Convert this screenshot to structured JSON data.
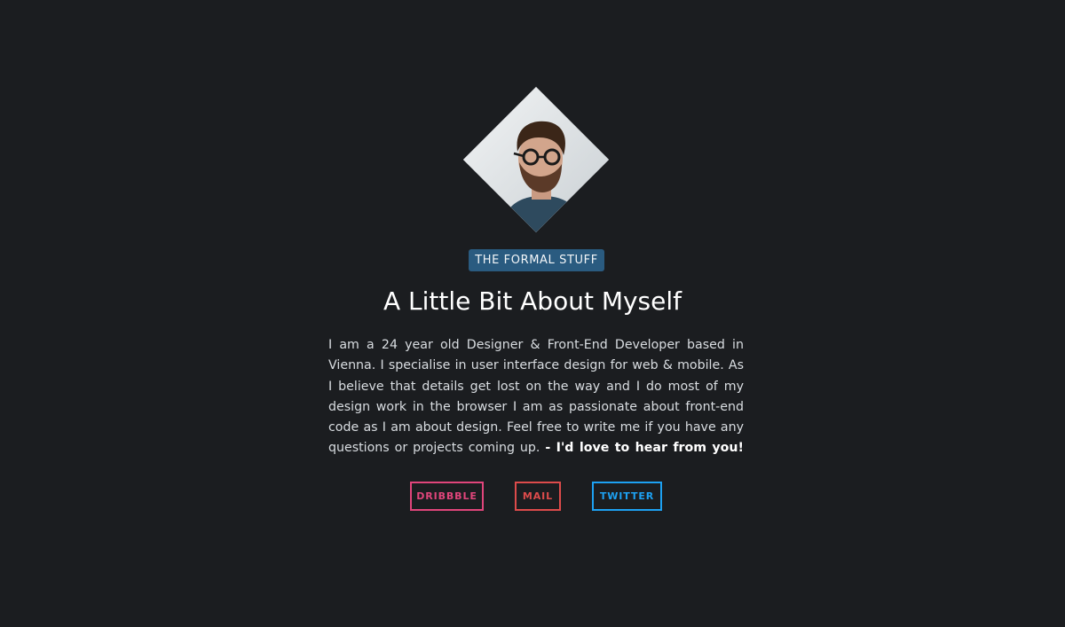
{
  "profile": {
    "avatar_icon": "portrait-photo"
  },
  "badge": {
    "label": "THE FORMAL STUFF"
  },
  "heading": {
    "title": "A Little Bit About Myself"
  },
  "bio": {
    "text": "I am a 24 year old Designer & Front-End Developer based in Vienna. I specialise in user interface design for web & mobile. As I believe that details get lost on the way and I do most of my design work in the browser I am as passionate about front-end code as I am about design. Feel free to write me if you have any questions or projects coming up.",
    "closing": "- I'd love to hear from you!"
  },
  "links": {
    "dribbble": "DRIBBBLE",
    "mail": "MAIL",
    "twitter": "TWITTER"
  },
  "colors": {
    "background": "#1b1d20",
    "badge": "#2a5b80",
    "dribbble": "#e0457b",
    "mail": "#dd4b4b",
    "twitter": "#1da1f2"
  }
}
